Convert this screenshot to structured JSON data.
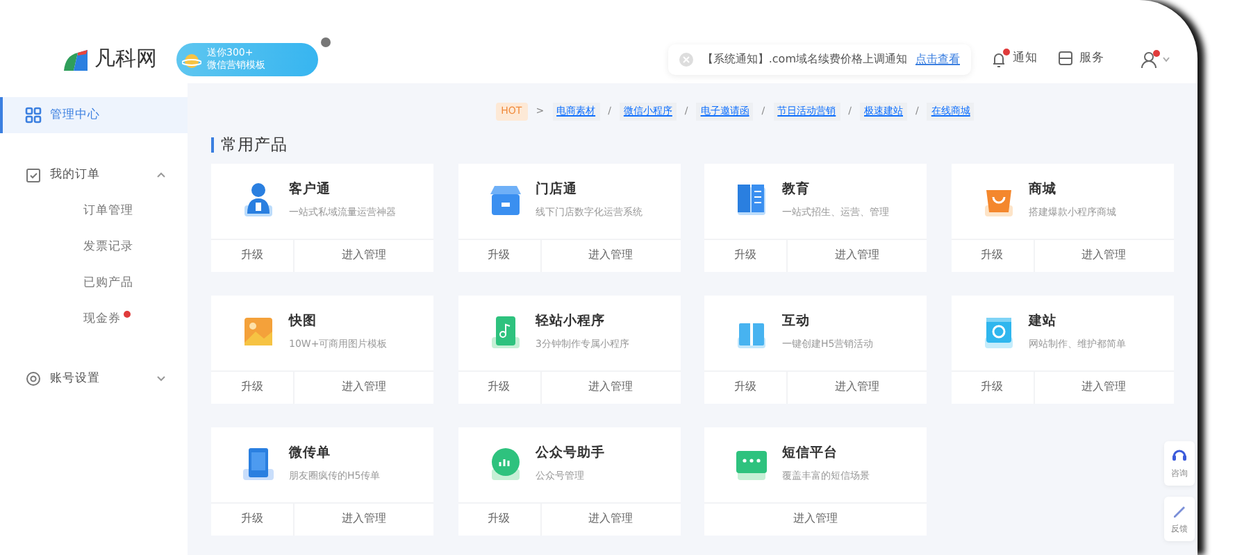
{
  "header": {
    "logo": "凡科网",
    "promo": {
      "line1": "送你300+",
      "line2": "微信营销模板"
    },
    "notice": {
      "text": "【系统通知】.com域名续费价格上调通知",
      "link": "点击查看"
    },
    "actions": [
      {
        "kind": "bell",
        "label": "通知",
        "dot": true
      },
      {
        "kind": "service",
        "label": "服务",
        "dot": false
      }
    ],
    "user": {
      "dot": true
    }
  },
  "sidebar": {
    "items": [
      {
        "label": "管理中心",
        "kind": "grid",
        "selected": true
      },
      {
        "label": "我的订单",
        "kind": "order",
        "selected": false,
        "expanded": true,
        "children": [
          {
            "label": "订单管理",
            "dot": false
          },
          {
            "label": "发票记录",
            "dot": false
          },
          {
            "label": "已购产品",
            "dot": false
          },
          {
            "label": "现金券",
            "dot": true
          }
        ]
      },
      {
        "label": "账号设置",
        "kind": "gear",
        "selected": false,
        "expanded": false
      }
    ]
  },
  "breadcrumb": {
    "badge": "HOT",
    "items": [
      {
        "sep": ">",
        "label": "电商素材"
      },
      {
        "sep": "/",
        "label": "微信小程序"
      },
      {
        "sep": "/",
        "label": "电子邀请函"
      },
      {
        "sep": "/",
        "label": "节日活动营销"
      },
      {
        "sep": "/",
        "label": "极速建站"
      },
      {
        "sep": "/",
        "label": "在线商城"
      }
    ]
  },
  "section_title": "常用产品",
  "products": [
    {
      "title": "客户通",
      "desc": "一站式私域流量运营神器",
      "actions": [
        "升级",
        "进入管理"
      ]
    },
    {
      "title": "门店通",
      "desc": "线下门店数字化运营系统",
      "actions": [
        "升级",
        "进入管理"
      ]
    },
    {
      "title": "教育",
      "desc": "一站式招生、运营、管理",
      "actions": [
        "升级",
        "进入管理"
      ]
    },
    {
      "title": "商城",
      "desc": "搭建爆款小程序商城",
      "actions": [
        "升级",
        "进入管理"
      ]
    },
    {
      "title": "快图",
      "desc": "10W+可商用图片模板",
      "actions": [
        "升级",
        "进入管理"
      ]
    },
    {
      "title": "轻站小程序",
      "desc": "3分钟制作专属小程序",
      "actions": [
        "升级",
        "进入管理"
      ]
    },
    {
      "title": "互动",
      "desc": "一键创建H5营销活动",
      "actions": [
        "升级",
        "进入管理"
      ]
    },
    {
      "title": "建站",
      "desc": "网站制作、维护都简单",
      "actions": [
        "升级",
        "进入管理"
      ]
    },
    {
      "title": "微传单",
      "desc": "朋友圈疯传的H5传单",
      "actions": [
        "升级",
        "进入管理"
      ]
    },
    {
      "title": "公众号助手",
      "desc": "公众号管理",
      "actions": [
        "升级",
        "进入管理"
      ]
    },
    {
      "title": "短信平台",
      "desc": "覆盖丰富的短信场景",
      "actions": [
        "进入管理"
      ]
    }
  ],
  "float_buttons": [
    {
      "kind": "headset",
      "label": "咨询"
    },
    {
      "kind": "pencil",
      "label": "反馈"
    }
  ]
}
